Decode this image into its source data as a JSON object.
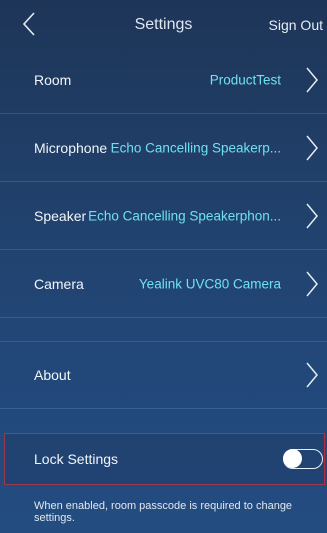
{
  "header": {
    "title": "Settings",
    "signout_label": "Sign Out"
  },
  "rows": [
    {
      "label": "Room",
      "value": "ProductTest"
    },
    {
      "label": "Microphone",
      "value": "Echo Cancelling Speakerp..."
    },
    {
      "label": "Speaker",
      "value": "Echo Cancelling Speakerphon..."
    },
    {
      "label": "Camera",
      "value": "Yealink UVC80 Camera"
    },
    {
      "label": "About",
      "value": ""
    }
  ],
  "lock": {
    "label": "Lock Settings",
    "enabled": false,
    "help": "When enabled, room passcode is required to change settings."
  },
  "colors": {
    "accent_value": "#6fe0f2",
    "lock_border": "#9a3a4a"
  },
  "icons": {
    "back": "chevron-left-icon",
    "row_arrow": "chevron-right-icon"
  }
}
